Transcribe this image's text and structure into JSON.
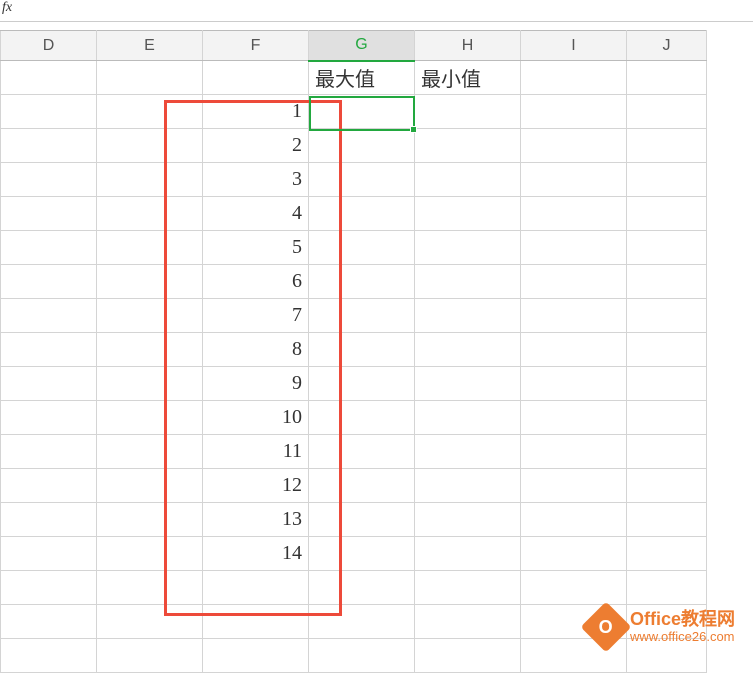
{
  "formula_bar": {
    "fx_label": "fx"
  },
  "columns": [
    {
      "letter": "D",
      "class": "col-D"
    },
    {
      "letter": "E",
      "class": "col-E"
    },
    {
      "letter": "F",
      "class": "col-F"
    },
    {
      "letter": "G",
      "class": "col-G",
      "selected": true
    },
    {
      "letter": "H",
      "class": "col-H"
    },
    {
      "letter": "I",
      "class": "col-I"
    },
    {
      "letter": "J",
      "class": "col-J"
    }
  ],
  "headers": {
    "G": "最大值",
    "H": "最小值"
  },
  "data_column_F": [
    1,
    2,
    3,
    4,
    5,
    6,
    7,
    8,
    9,
    10,
    11,
    12,
    13,
    14
  ],
  "selected_cell": "G2",
  "watermark": {
    "logo_text": "O",
    "title": "Office教程网",
    "url": "www.office26.com"
  }
}
